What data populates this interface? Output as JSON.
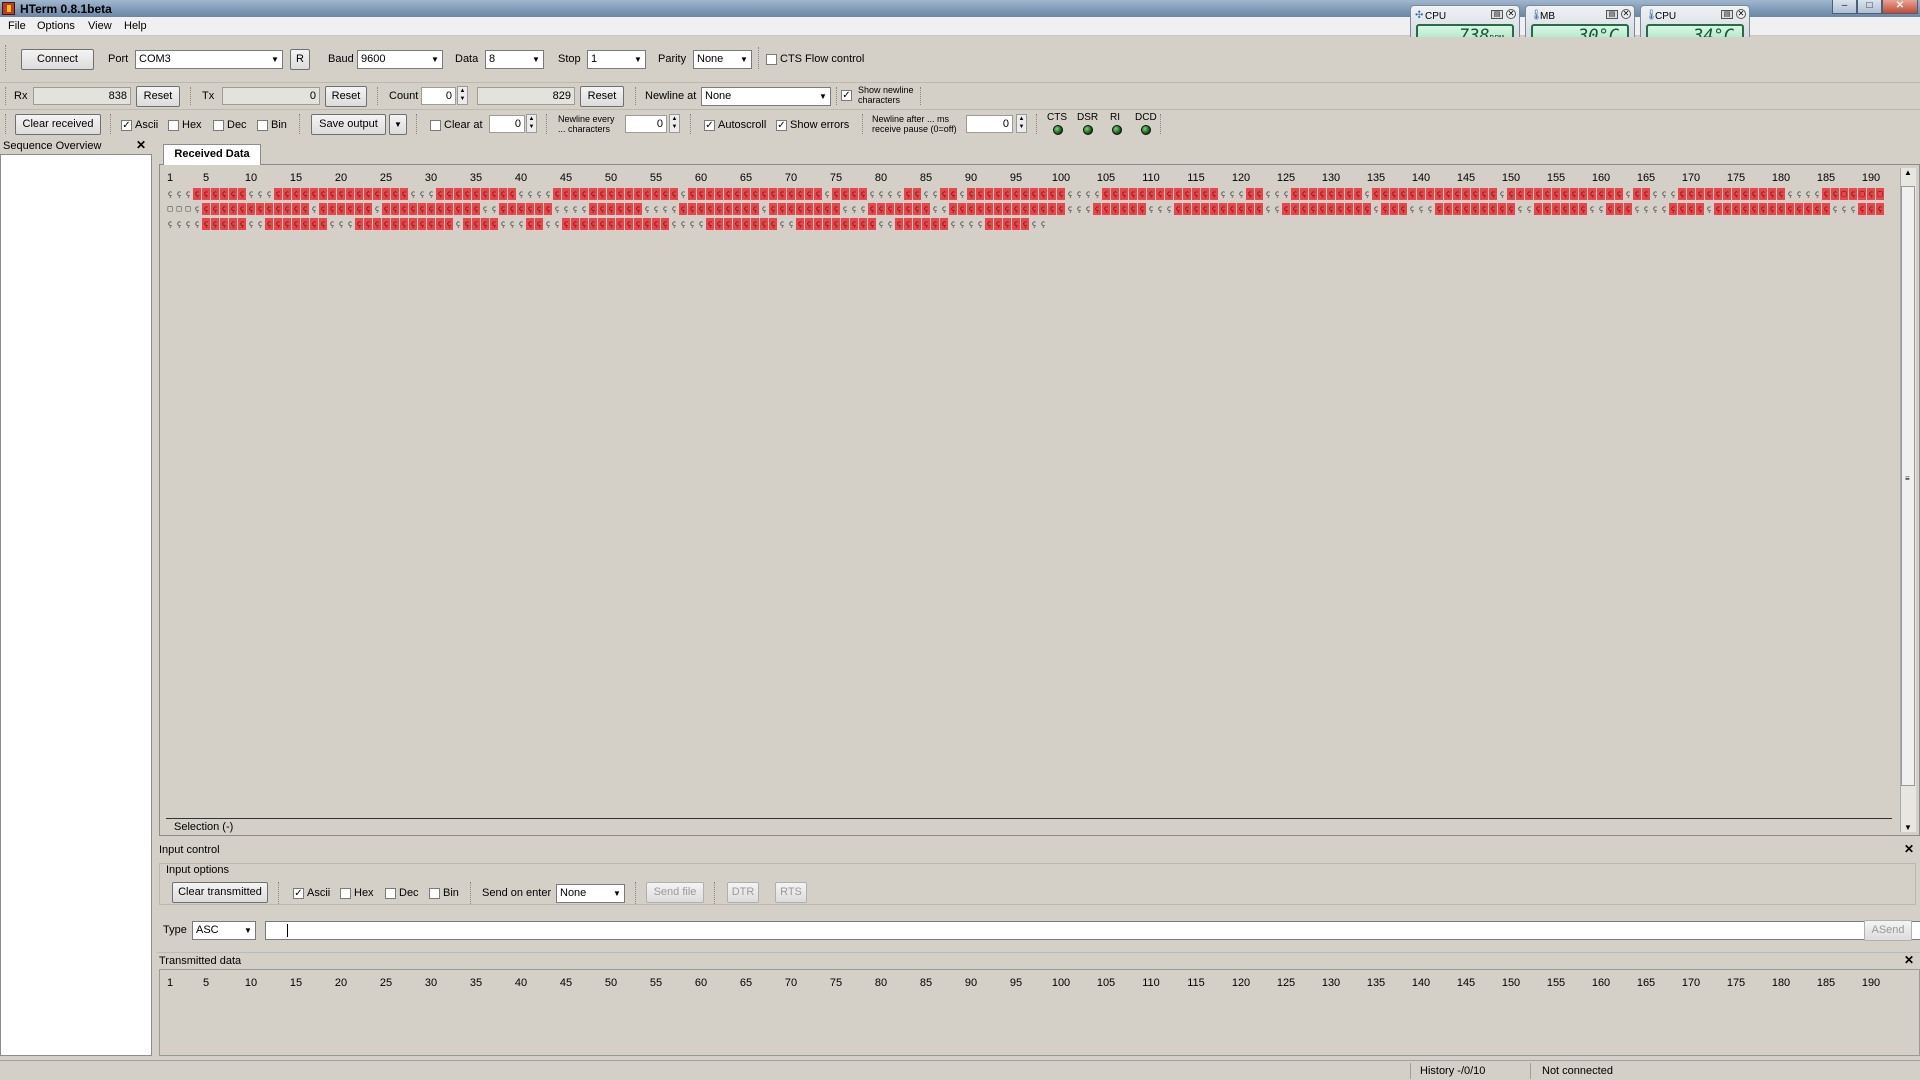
{
  "window": {
    "title": "HTerm 0.8.1beta",
    "minimize": "–",
    "maximize": "□",
    "close": "✕"
  },
  "menu": [
    "File",
    "Options",
    "View",
    "Help"
  ],
  "widgets": [
    {
      "title": "CPU",
      "value": "738",
      "unit": "RPM",
      "icon": "fan-icon"
    },
    {
      "title": "MB",
      "value": "30°C",
      "unit": "",
      "icon": "thermometer-icon"
    },
    {
      "title": "CPU",
      "value": "34°C",
      "unit": "",
      "icon": "thermometer-icon"
    }
  ],
  "connection": {
    "connect_label": "Connect",
    "port_label": "Port",
    "port_value": "COM3",
    "refresh_label": "R",
    "baud_label": "Baud",
    "baud_value": "9600",
    "data_label": "Data",
    "data_value": "8",
    "stop_label": "Stop",
    "stop_value": "1",
    "parity_label": "Parity",
    "parity_value": "None",
    "cts_label": "CTS Flow control"
  },
  "counters": {
    "rx_label": "Rx",
    "rx_value": "838",
    "rx_reset": "Reset",
    "tx_label": "Tx",
    "tx_value": "0",
    "tx_reset": "Reset",
    "count_label": "Count",
    "count_value": "0",
    "count_total": "829",
    "count_reset": "Reset",
    "newline_at_label": "Newline at",
    "newline_at_value": "None",
    "show_newline_label_1": "Show newline",
    "show_newline_label_2": "characters"
  },
  "receive_options": {
    "clear_received": "Clear received",
    "ascii": "Ascii",
    "hex": "Hex",
    "dec": "Dec",
    "bin": "Bin",
    "save_output": "Save output",
    "clear_at_label": "Clear at",
    "clear_at_value": "0",
    "newline_every_1": "Newline every",
    "newline_every_2": "... characters",
    "newline_every_value": "0",
    "autoscroll": "Autoscroll",
    "show_errors": "Show errors",
    "newline_after_1": "Newline after ... ms",
    "newline_after_2": "receive pause (0=off)",
    "newline_after_value": "0",
    "leds": [
      "CTS",
      "DSR",
      "RI",
      "DCD"
    ]
  },
  "sequence_overview": {
    "title": "Sequence Overview"
  },
  "received": {
    "tab_label": "Received Data",
    "ruler": [
      "1",
      "5",
      "10",
      "15",
      "20",
      "25",
      "30",
      "35",
      "40",
      "45",
      "50",
      "55",
      "60",
      "65",
      "70",
      "75",
      "80",
      "85",
      "90",
      "95",
      "100",
      "105",
      "110",
      "115",
      "120",
      "125",
      "130",
      "135",
      "140",
      "145",
      "150",
      "155",
      "160",
      "165",
      "170",
      "175",
      "180",
      "185",
      "190"
    ],
    "selection_label": "Selection (-)"
  },
  "input_control": {
    "title": "Input control",
    "options_title": "Input options",
    "clear_transmitted": "Clear transmitted",
    "ascii": "Ascii",
    "hex": "Hex",
    "dec": "Dec",
    "bin": "Bin",
    "send_on_enter_label": "Send on enter",
    "send_on_enter_value": "None",
    "send_file": "Send file",
    "dtr": "DTR",
    "rts": "RTS",
    "type_label": "Type",
    "type_value": "ASC",
    "asend": "ASend"
  },
  "transmitted": {
    "title": "Transmitted data",
    "ruler": [
      "1",
      "5",
      "10",
      "15",
      "20",
      "25",
      "30",
      "35",
      "40",
      "45",
      "50",
      "55",
      "60",
      "65",
      "70",
      "75",
      "80",
      "85",
      "90",
      "95",
      "100",
      "105",
      "110",
      "115",
      "120",
      "125",
      "130",
      "135",
      "140",
      "145",
      "150",
      "155",
      "160",
      "165",
      "170",
      "175",
      "180",
      "185",
      "190"
    ]
  },
  "status": {
    "history": "History -/0/10",
    "connection": "Not connected"
  }
}
